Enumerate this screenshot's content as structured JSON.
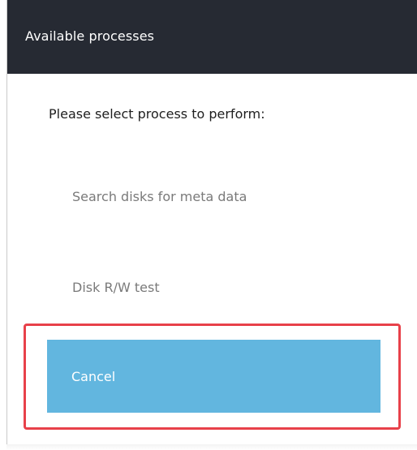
{
  "dialog": {
    "title": "Available processes",
    "prompt": "Please select process to perform:",
    "options": [
      {
        "label": "Search disks for meta data"
      },
      {
        "label": "Disk R/W test"
      }
    ],
    "cancel_label": "Cancel"
  },
  "colors": {
    "titlebar_bg": "#262a33",
    "cancel_bg": "#62b6df",
    "highlight_border": "#e8414a",
    "option_text": "#7a7a7a"
  }
}
